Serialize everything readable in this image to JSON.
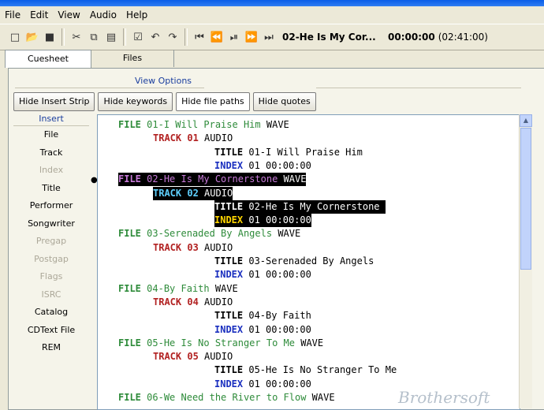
{
  "menu": [
    "File",
    "Edit",
    "View",
    "Audio",
    "Help"
  ],
  "toolbar": {
    "buttons": [
      "new-file-icon",
      "open-folder-icon",
      "save-icon",
      "cut-icon",
      "copy-icon",
      "paste-icon",
      "properties-icon",
      "undo-icon",
      "redo-icon"
    ],
    "transport": [
      "⏮",
      "⏪",
      "⏯",
      "⏩",
      "⏭"
    ],
    "current_track": "02-He Is My Cor...",
    "position": "00:00:00",
    "total": "(02:41:00)"
  },
  "tabs": [
    "Cuesheet",
    "Files"
  ],
  "view_options": {
    "label": "View Options",
    "buttons": [
      "Hide Insert Strip",
      "Hide keywords",
      "Hide file paths",
      "Hide quotes"
    ]
  },
  "insert_strip": {
    "title": "Insert",
    "items": [
      {
        "label": "File",
        "enabled": true
      },
      {
        "label": "Track",
        "enabled": true
      },
      {
        "label": "Index",
        "enabled": false
      },
      {
        "label": "Title",
        "enabled": true
      },
      {
        "label": "Performer",
        "enabled": true
      },
      {
        "label": "Songwriter",
        "enabled": true
      },
      {
        "label": "Pregap",
        "enabled": false
      },
      {
        "label": "Postgap",
        "enabled": false
      },
      {
        "label": "Flags",
        "enabled": false
      },
      {
        "label": "ISRC",
        "enabled": false
      },
      {
        "label": "Catalog",
        "enabled": true
      },
      {
        "label": "CDText File",
        "enabled": true
      },
      {
        "label": "REM",
        "enabled": true
      }
    ]
  },
  "cue_lines": [
    {
      "kw": "FILE",
      "text": "01-I Will Praise Him",
      "tail": "WAVE",
      "type": "file",
      "sel": false
    },
    {
      "kw": "TRACK",
      "text": "01",
      "tail": "AUDIO",
      "type": "track",
      "sel": false
    },
    {
      "kw": "TITLE",
      "text": "01-I Will Praise Him",
      "tail": "",
      "type": "title",
      "sel": false
    },
    {
      "kw": "INDEX",
      "text": "01",
      "tail": "00:00:00",
      "type": "index",
      "sel": false
    },
    {
      "kw": "FILE",
      "text": "02-He Is My Cornerstone",
      "tail": "WAVE",
      "type": "file",
      "sel": true
    },
    {
      "kw": "TRACK",
      "text": "02",
      "tail": "AUDIO",
      "type": "track",
      "sel": true
    },
    {
      "kw": "TITLE",
      "text": "02-He Is My Cornerstone",
      "tail": "",
      "type": "title",
      "sel": true
    },
    {
      "kw": "INDEX",
      "text": "01",
      "tail": "00:00:00",
      "type": "index",
      "sel": true
    },
    {
      "kw": "FILE",
      "text": "03-Serenaded By Angels",
      "tail": "WAVE",
      "type": "file",
      "sel": false
    },
    {
      "kw": "TRACK",
      "text": "03",
      "tail": "AUDIO",
      "type": "track",
      "sel": false
    },
    {
      "kw": "TITLE",
      "text": "03-Serenaded By Angels",
      "tail": "",
      "type": "title",
      "sel": false
    },
    {
      "kw": "INDEX",
      "text": "01",
      "tail": "00:00:00",
      "type": "index",
      "sel": false
    },
    {
      "kw": "FILE",
      "text": "04-By Faith",
      "tail": "WAVE",
      "type": "file",
      "sel": false
    },
    {
      "kw": "TRACK",
      "text": "04",
      "tail": "AUDIO",
      "type": "track",
      "sel": false
    },
    {
      "kw": "TITLE",
      "text": "04-By Faith",
      "tail": "",
      "type": "title",
      "sel": false
    },
    {
      "kw": "INDEX",
      "text": "01",
      "tail": "00:00:00",
      "type": "index",
      "sel": false
    },
    {
      "kw": "FILE",
      "text": "05-He Is No Stranger To Me",
      "tail": "WAVE",
      "type": "file",
      "sel": false
    },
    {
      "kw": "TRACK",
      "text": "05",
      "tail": "AUDIO",
      "type": "track",
      "sel": false
    },
    {
      "kw": "TITLE",
      "text": "05-He Is No Stranger To Me",
      "tail": "",
      "type": "title",
      "sel": false
    },
    {
      "kw": "INDEX",
      "text": "01",
      "tail": "00:00:00",
      "type": "index",
      "sel": false
    },
    {
      "kw": "FILE",
      "text": "06-We Need the River to Flow",
      "tail": "WAVE",
      "type": "file",
      "sel": false
    }
  ],
  "watermark": "Brothersoft"
}
